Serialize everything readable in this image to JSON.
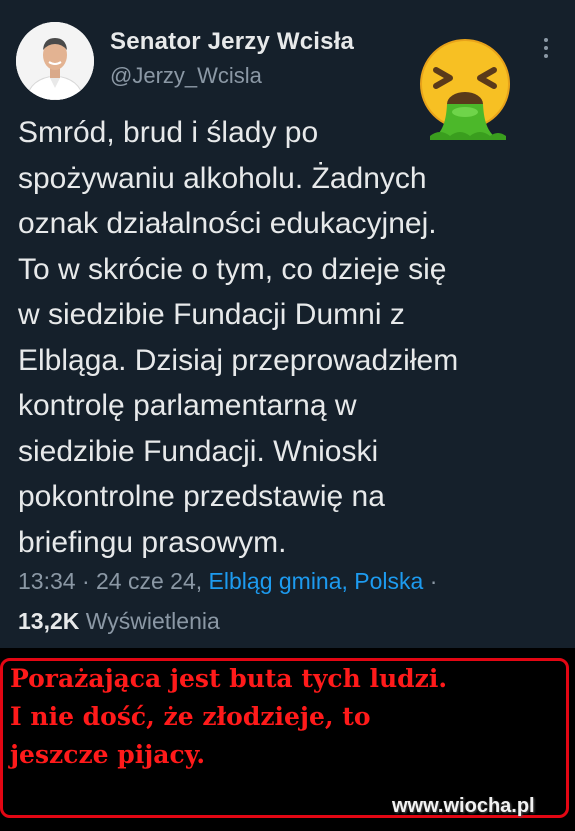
{
  "tweet": {
    "author": {
      "display_name": "Senator Jerzy Wcisła",
      "handle": "@Jerzy_Wcisla"
    },
    "reaction_emoji": "vomiting-face-emoji",
    "more_icon": "more-vertical-icon",
    "text_lines": [
      "Smród, brud i ślady po",
      "spożywaniu alkoholu. Żadnych",
      "oznak działalności edukacyjnej.",
      "To w skrócie o tym, co dzieje się",
      "w siedzibie Fundacji Dumni z",
      "Elbląga. Dzisiaj przeprowadziłem",
      "kontrolę parlamentarną w",
      "siedzibie Fundacji. Wnioski",
      "pokontrolne przedstawię na",
      "briefingu prasowym."
    ],
    "time": "13:34",
    "sep1": " · ",
    "date": "24 cze 24",
    "sep2": ", ",
    "location": "Elbląg gmina, Polska",
    "sep3": " ·",
    "views_count": "13,2K",
    "views_label": " Wyświetlenia",
    "colors": {
      "background": "#15202b",
      "text": "#e7e9ea",
      "muted": "#8b98a5",
      "link": "#1d9bf0"
    }
  },
  "caption": {
    "lines": [
      "Porażająca jest buta tych ludzi.",
      "I nie dość, że złodzieje, to",
      "jeszcze pijacy."
    ],
    "color": "#ff1a1a",
    "border_color": "#e30613"
  },
  "watermark": "www.wiocha.pl"
}
